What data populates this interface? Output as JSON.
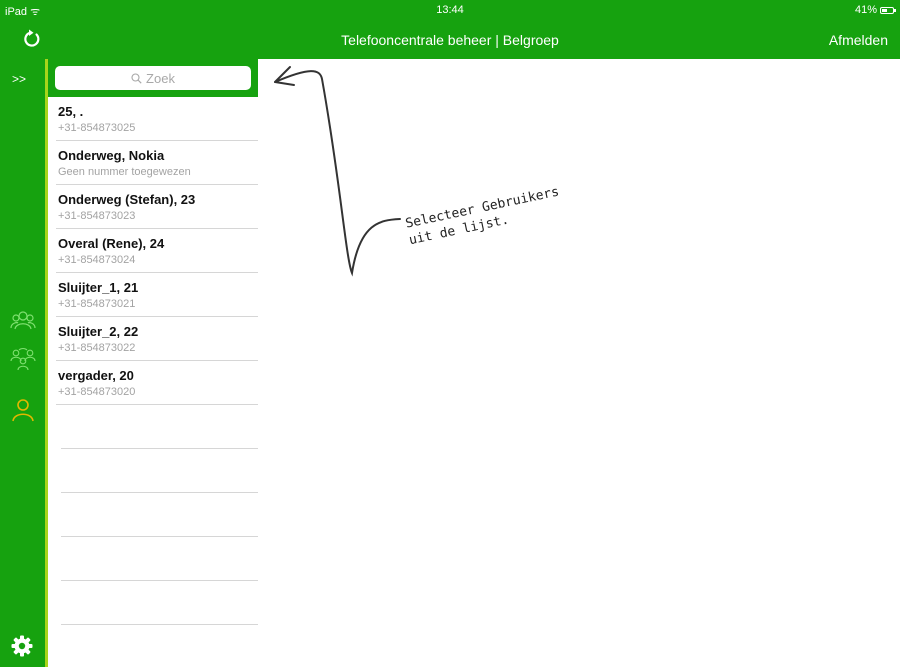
{
  "status_bar": {
    "device": "iPad",
    "time": "13:44",
    "battery_level": "41%"
  },
  "nav_bar": {
    "title": "Telefooncentrale beheer | Belgroep",
    "logout_label": "Afmelden",
    "refresh_icon": "refresh-icon"
  },
  "sidebar": {
    "expand_label": ">>",
    "icons": [
      "users-icon",
      "group-icon",
      "user-icon",
      "gear-icon"
    ],
    "active_icon_color": "#e2b800"
  },
  "search": {
    "placeholder": "Zoek"
  },
  "users": [
    {
      "name": "25, .",
      "number": "+31-854873025"
    },
    {
      "name": "Onderweg, Nokia",
      "number": "Geen nummer toegewezen"
    },
    {
      "name": "Onderweg (Stefan), 23",
      "number": "+31-854873023"
    },
    {
      "name": "Overal (Rene), 24",
      "number": "+31-854873024"
    },
    {
      "name": "Sluijter_1, 21",
      "number": "+31-854873021"
    },
    {
      "name": "Sluijter_2, 22",
      "number": "+31-854873022"
    },
    {
      "name": "vergader, 20",
      "number": "+31-854873020"
    }
  ],
  "annotation": {
    "line1": "Selecteer Gebruikers",
    "line2": "uit de lijst."
  },
  "colors": {
    "brand_green": "#16a20f",
    "edge_lime": "#a8d51b"
  }
}
